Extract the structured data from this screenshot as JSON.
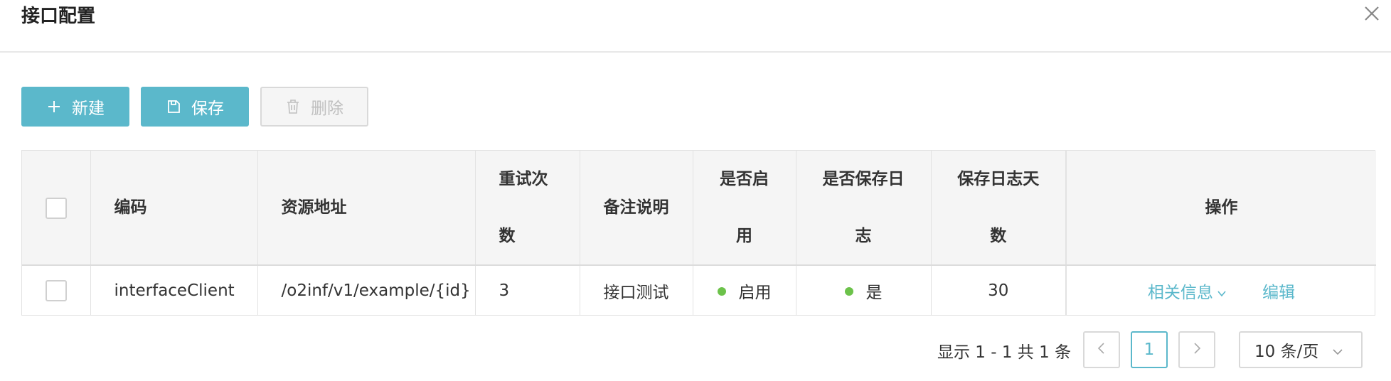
{
  "modal": {
    "title": "接口配置",
    "close_icon": "close-icon"
  },
  "toolbar": {
    "new_label": "新建",
    "save_label": "保存",
    "delete_label": "删除",
    "accent": "#5bb8cb"
  },
  "table": {
    "headers": {
      "code": "编码",
      "resource": "资源地址",
      "retries": [
        "重试次",
        "数"
      ],
      "remark": "备注说明",
      "enabled": [
        "是否启",
        "用"
      ],
      "save_log": [
        "是否保存日",
        "志"
      ],
      "log_days": [
        "保存日志天",
        "数"
      ],
      "actions": "操作"
    },
    "rows": [
      {
        "code": "interfaceClient",
        "resource": "/o2inf/v1/example/{id}",
        "retries": "3",
        "remark": "接口测试",
        "enabled": "启用",
        "save_log": "是",
        "log_days": "30",
        "action_related": "相关信息",
        "action_edit": "编辑"
      }
    ],
    "status_color": "#6cc24a"
  },
  "pagination": {
    "info": "显示 1 - 1 共 1 条",
    "current_page": "1",
    "page_size": "10 条/页"
  }
}
